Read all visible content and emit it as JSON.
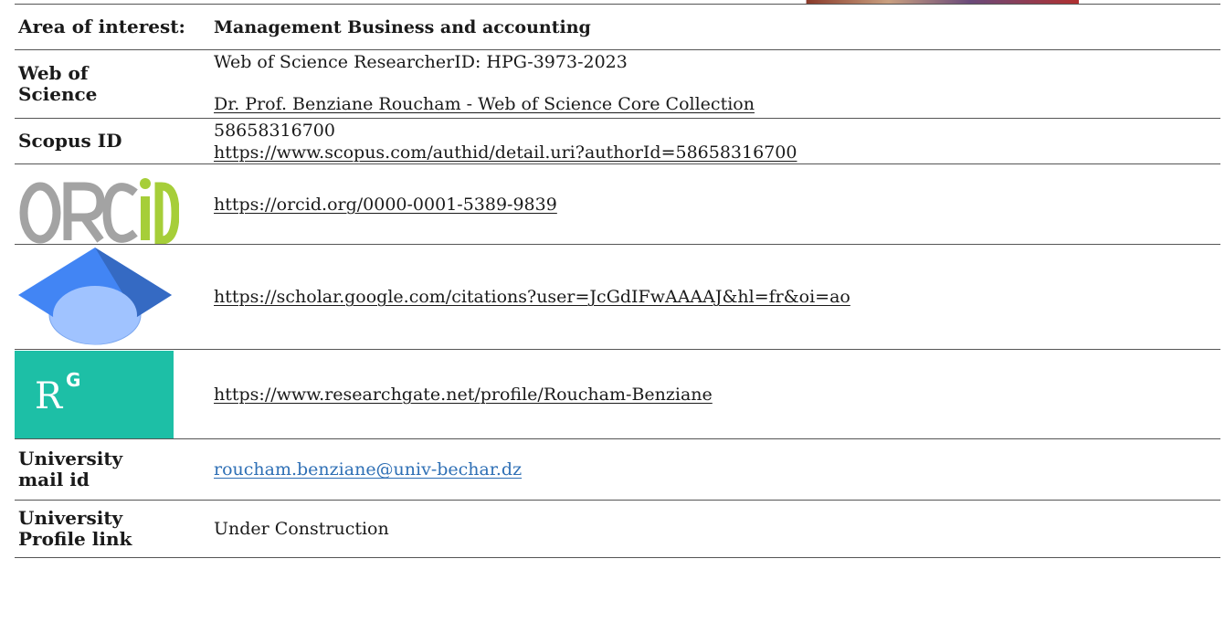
{
  "rows": {
    "area": {
      "label": "Area of interest:",
      "value": "Management Business and accounting"
    },
    "wos": {
      "label": "Web of Science",
      "researcher_id": "Web of Science ResearcherID:  HPG-3973-2023",
      "link": "Dr. Prof.  Benziane Roucham - Web of Science Core Collection"
    },
    "scopus": {
      "label": "Scopus ID",
      "id": "58658316700",
      "link": "https://www.scopus.com/authid/detail.uri?authorId=58658316700"
    },
    "orcid": {
      "logo_text": "ORCID",
      "link": "https://orcid.org/0000-0001-5389-9839"
    },
    "scholar": {
      "icon": "graduation-cap-icon",
      "link": "https://scholar.google.com/citations?user=JcGdIFwAAAAJ&hl=fr&oi=ao"
    },
    "researchgate": {
      "logo_text": "R",
      "logo_sup": "G",
      "link": "https://www.researchgate.net/profile/Roucham-Benziane"
    },
    "mail": {
      "label": "University mail id",
      "value": "roucham.benziane@univ-bechar.dz"
    },
    "profile": {
      "label": "University Profile link",
      "value": "Under Construction"
    }
  },
  "colors": {
    "orcid_gray": "#a3a3a3",
    "orcid_green": "#a6ce39",
    "scholar_blue_dark": "#4285f4",
    "scholar_blue_light": "#a0c3ff",
    "researchgate_teal": "#1dbfa6",
    "mail_link": "#2e6fb5"
  }
}
